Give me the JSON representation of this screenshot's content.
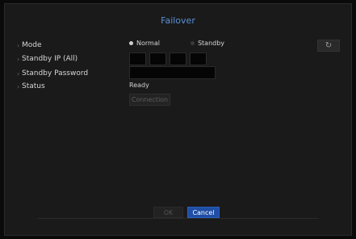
{
  "title": "Failover",
  "form": {
    "mode_label": "Mode",
    "mode_options": [
      "Normal",
      "Standby"
    ],
    "standby_ip_label": "Standby IP (All)",
    "standby_password_label": "Standby Password",
    "status_label": "Status",
    "status_value": "Ready",
    "connection_label": "Connection"
  },
  "footer": {
    "ok_label": "OK",
    "cancel_label": "Cancel"
  },
  "icons": {
    "refresh": "refresh-icon",
    "bullet": "bullet-icon"
  }
}
